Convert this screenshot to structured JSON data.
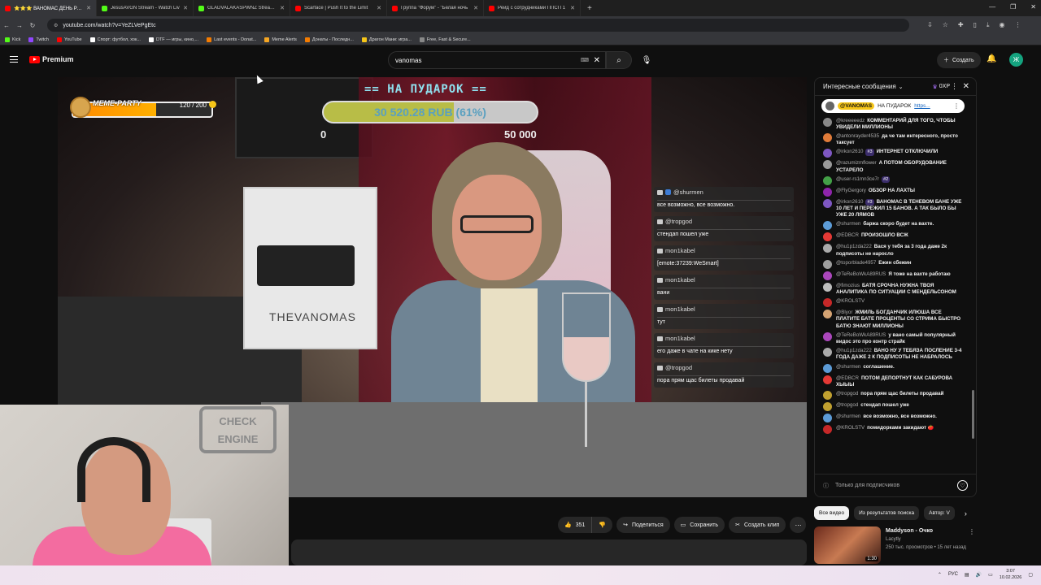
{
  "browser": {
    "tabs": [
      {
        "label": "⭐⭐⭐ ВАНОМАС ДЕНЬ РОЖ",
        "color": "#ff0000",
        "active": true
      },
      {
        "label": "JesusAVGN Stream - Watch Liv",
        "color": "#53fc18"
      },
      {
        "label": "GLADVALAKASPWNZ Stream -",
        "color": "#53fc18"
      },
      {
        "label": "Scarface | Push It to the Limit",
        "color": "#ff0000"
      },
      {
        "label": "Группа \"Форум\" - \"Белая ночь",
        "color": "#ff0000"
      },
      {
        "label": "Рейд с сотрудниками ППСП 1",
        "color": "#ff0000"
      }
    ],
    "new_tab": "+",
    "url": "youtube.com/watch?v=YeZLVePgEtc",
    "bookmarks": [
      {
        "label": "Kick",
        "color": "#53fc18"
      },
      {
        "label": "Twitch",
        "color": "#9146ff"
      },
      {
        "label": "YouTube",
        "color": "#ff0000"
      },
      {
        "label": "Спорт: футбол, хок...",
        "color": "#ffffff"
      },
      {
        "label": "DTF — игры, кино,...",
        "color": "#ffffff"
      },
      {
        "label": "Last events - Donat...",
        "color": "#f57c00"
      },
      {
        "label": "Meme Alerts",
        "color": "#f5a623"
      },
      {
        "label": "Донаты - Последн...",
        "color": "#f57c00"
      },
      {
        "label": "Драгон Мани: игра...",
        "color": "#f5c518"
      },
      {
        "label": "Free, Fast & Secure...",
        "color": "#888888"
      }
    ]
  },
  "youtube": {
    "logo": "Premium",
    "search_value": "vanomas",
    "create_label": "Создать",
    "avatar_letter": "Ж"
  },
  "stream_overlay": {
    "meme_label": "MEME-PARTY",
    "meme_value": "120 / 200",
    "meme_progress": 0.6,
    "goal_title": "== НА ПУДАРОК ==",
    "goal_amount": "30 520.28 RUB (61%)",
    "goal_progress": 0.61,
    "goal_min": "0",
    "goal_max": "50 000",
    "pc_brand": "THEVANOMAS",
    "webcam_sign": "CHECK ENGINE",
    "chat": [
      {
        "name": "@shurmen",
        "text": "все возможно, все возможно."
      },
      {
        "name": "@tropgod",
        "text": "стендап пошел уже"
      },
      {
        "name": "mon1kabel",
        "text": "[emote:37239:WeSmart]"
      },
      {
        "name": "mon1kabel",
        "text": "вани"
      },
      {
        "name": "mon1kabel",
        "text": "тут"
      },
      {
        "name": "mon1kabel",
        "text": "его даже в чате на кике нету"
      },
      {
        "name": "@tropgod",
        "text": "пора прям щас билеты продавай"
      }
    ]
  },
  "live_chat": {
    "header": "Интересные сообщения",
    "xp": "0XP",
    "pinned_name": "@VANOMAS",
    "pinned_text": "НА ПУДАРОК",
    "pinned_link": "https...",
    "messages": [
      {
        "name": "@kreeeeedz",
        "badge": "",
        "text": "КОММЕНТАРИЙ ДЛЯ ТОГО, ЧТОБЫ УВИДЕЛИ МИЛЛИОНЫ",
        "color": "#888888"
      },
      {
        "name": "@antonrayder4535",
        "badge": "",
        "text": "да че там интересного, просто таксует",
        "color": "#e07b39"
      },
      {
        "name": "@irkon2610",
        "badge": "#3",
        "text": "ИНТЕРНЕТ ОТКЛЮЧИЛИ",
        "color": "#7e57c2"
      },
      {
        "name": "@razumizmflower",
        "badge": "",
        "text": "А ПОТОМ ОБОРУДОВАНИЕ УСТАРЕЛО",
        "color": "#999999"
      },
      {
        "name": "@user-rs1mn3ce7r",
        "badge": "#2",
        "text": "",
        "color": "#43a047"
      },
      {
        "name": "@FlyGergory",
        "badge": "",
        "text": "ОБЗОР НА ЛАХТЫ",
        "color": "#8e24aa"
      },
      {
        "name": "@irkon2610",
        "badge": "#3",
        "text": "ВАНОМАС В ТЕНЕВОМ БАНЕ УЖЕ 10 ЛЕТ И ПЕРЕЖИЛ 15 БАНОВ. А ТАК БЫЛО БЫ УЖЕ 20 ЛЯМОВ",
        "color": "#7e57c2"
      },
      {
        "name": "@shurmen",
        "badge": "",
        "text": "баржа скоро будет на вахте.",
        "color": "#5c9bd6"
      },
      {
        "name": "@EDBCR",
        "badge": "",
        "text": "ПРОИЗОШЛО ВСЖ",
        "color": "#e53935"
      },
      {
        "name": "@hu1p1zda222",
        "badge": "",
        "text": "Вася у тебя за 3 года даже 2к подписоты не наросло",
        "color": "#aaaaaa"
      },
      {
        "name": "@toporblade4957",
        "badge": "",
        "text": "Ежин сбежин",
        "color": "#9e9e9e"
      },
      {
        "name": "@TeReBoWkA89RUS",
        "badge": "",
        "text": "Я тоже на вахте работаю",
        "color": "#ab47bc"
      },
      {
        "name": "@fimozius",
        "badge": "",
        "text": "БАТЯ СРОЧНА НУЖНА ТВОЯ АНАЛИТИКА ПО СИТУАЦИИ С МЕНДЕЛЬСОНОМ",
        "color": "#bdbdbd"
      },
      {
        "name": "@KROLSTV",
        "badge": "",
        "text": "",
        "color": "#c62828"
      },
      {
        "name": "@Blyor",
        "badge": "",
        "text": "ЖМИЛЬ БОГДАНЧИК ИЛЮША ВСЕ ПЛАТИТЕ БАТЕ ПРОЦЕНТЫ СО СТРИМА БЫСТРО БАТЮ ЗНАЮТ МИЛЛИОНЫ",
        "color": "#d4a373"
      },
      {
        "name": "@TeReBoWkA89RUS",
        "badge": "",
        "text": "у вано самый популярный видос это про контр страйк",
        "color": "#ab47bc"
      },
      {
        "name": "@hu1p1zda222",
        "badge": "",
        "text": "ВАНО НУ У ТЕБЯЗА ПОСЛЕНИЕ 3-4 ГОДА ДАЖЕ 2 К ПОДПИСОТЫ НЕ НАБРАЛОСЬ",
        "color": "#aaaaaa"
      },
      {
        "name": "@shurmen",
        "badge": "",
        "text": "соглашение.",
        "color": "#5c9bd6"
      },
      {
        "name": "@EDBCR",
        "badge": "",
        "text": "ПОТОМ ДЕПОРТНУТ КАК САБУРОВА ХЫЫЫ",
        "color": "#e53935"
      },
      {
        "name": "@tropgod",
        "badge": "",
        "text": "пора прям щас билеты продавай",
        "color": "#c0a030"
      },
      {
        "name": "@tropgod",
        "badge": "",
        "text": "стендап пошел уже",
        "color": "#c0a030"
      },
      {
        "name": "@shurmen",
        "badge": "",
        "text": "все возможно, все возможно.",
        "color": "#5c9bd6"
      },
      {
        "name": "@KROLSTV",
        "badge": "",
        "text": "помидорками закидают 🍅",
        "color": "#c62828"
      }
    ],
    "footer_text": "Только для подписчиков"
  },
  "actions": {
    "likes": "351",
    "share": "Поделиться",
    "save": "Сохранить",
    "clip": "Создать клип"
  },
  "chips": [
    "Все видео",
    "Из результатов поиска",
    "Автор: V"
  ],
  "recommendation": {
    "title": "Maddyson - Очко",
    "channel": "Lacytly",
    "meta": "250 тыс. просмотров • 15 лет назад",
    "duration": "1:30"
  },
  "taskbar": {
    "lang": "РУС",
    "time": "3:07",
    "date": "10.02.2026"
  }
}
